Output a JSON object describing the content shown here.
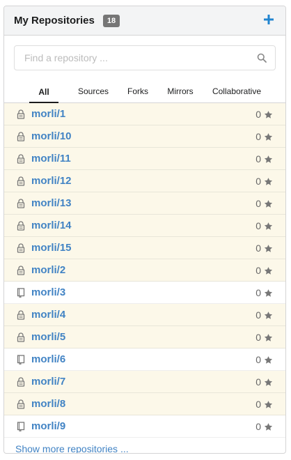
{
  "header": {
    "title": "My Repositories",
    "count": "18"
  },
  "search": {
    "placeholder": "Find a repository ..."
  },
  "tabs": [
    {
      "label": "All",
      "active": true
    },
    {
      "label": "Sources",
      "active": false
    },
    {
      "label": "Forks",
      "active": false
    },
    {
      "label": "Mirrors",
      "active": false
    },
    {
      "label": "Collaborative",
      "active": false
    }
  ],
  "repos": [
    {
      "name": "morli/1",
      "stars": "0",
      "private": true
    },
    {
      "name": "morli/10",
      "stars": "0",
      "private": true
    },
    {
      "name": "morli/11",
      "stars": "0",
      "private": true
    },
    {
      "name": "morli/12",
      "stars": "0",
      "private": true
    },
    {
      "name": "morli/13",
      "stars": "0",
      "private": true
    },
    {
      "name": "morli/14",
      "stars": "0",
      "private": true
    },
    {
      "name": "morli/15",
      "stars": "0",
      "private": true
    },
    {
      "name": "morli/2",
      "stars": "0",
      "private": true
    },
    {
      "name": "morli/3",
      "stars": "0",
      "private": false
    },
    {
      "name": "morli/4",
      "stars": "0",
      "private": true
    },
    {
      "name": "morli/5",
      "stars": "0",
      "private": true
    },
    {
      "name": "morli/6",
      "stars": "0",
      "private": false
    },
    {
      "name": "morli/7",
      "stars": "0",
      "private": true
    },
    {
      "name": "morli/8",
      "stars": "0",
      "private": true
    },
    {
      "name": "morli/9",
      "stars": "0",
      "private": false
    }
  ],
  "show_more": "Show more repositories ...",
  "colors": {
    "link": "#4183c4",
    "private_bg": "#fcf8e9",
    "header_bg": "#f3f4f5",
    "badge_bg": "#767676"
  },
  "icons": {
    "add": "plus-icon",
    "search": "search-icon",
    "private": "lock-icon",
    "public": "repo-book-icon",
    "star": "star-icon"
  }
}
